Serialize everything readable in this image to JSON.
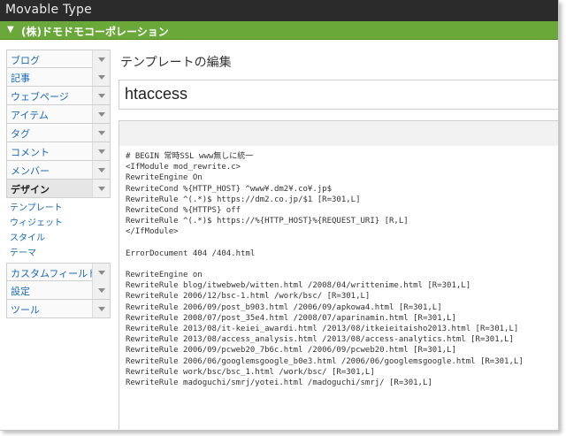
{
  "app": {
    "title": "Movable Type"
  },
  "site": {
    "name": "(株)ドモドモコーポレーション"
  },
  "sidebar": {
    "items_top": [
      {
        "label": "ブログ"
      },
      {
        "label": "記事"
      },
      {
        "label": "ウェブページ"
      },
      {
        "label": "アイテム"
      },
      {
        "label": "タグ"
      },
      {
        "label": "コメント"
      },
      {
        "label": "メンバー"
      }
    ],
    "active": {
      "label": "デザイン"
    },
    "sub_items": [
      {
        "label": "テンプレート"
      },
      {
        "label": "ウィジェット"
      },
      {
        "label": "スタイル"
      },
      {
        "label": "テーマ"
      }
    ],
    "items_bottom": [
      {
        "label": "カスタムフィールド"
      },
      {
        "label": "設定"
      },
      {
        "label": "ツール"
      }
    ]
  },
  "main": {
    "title": "テンプレートの編集",
    "template_name": "htaccess",
    "code": [
      "# BEGIN 常時SSL www無しに統一",
      "<IfModule mod_rewrite.c>",
      "RewriteEngine On",
      "RewriteCond %{HTTP_HOST} ^www¥.dm2¥.co¥.jp$",
      "RewriteRule ^(.*)$ https://dm2.co.jp/$1 [R=301,L]",
      "RewriteCond %{HTTPS} off",
      "RewriteRule ^(.*)$ https://%{HTTP_HOST}%{REQUEST_URI} [R,L]",
      "</IfModule>",
      "",
      "ErrorDocument 404 /404.html",
      "",
      "RewriteEngine on",
      "RewriteRule blog/itwebweb/witten.html /2008/04/writtenime.html [R=301,L]",
      "RewriteRule 2006/12/bsc-1.html /work/bsc/ [R=301,L]",
      "RewriteRule 2006/09/post_b903.html /2006/09/apkowa4.html [R=301,L]",
      "RewriteRule 2008/07/post_35e4.html /2008/07/aparinamin.html [R=301,L]",
      "RewriteRule 2013/08/it-keiei_awardi.html /2013/08/itkeieitaisho2013.html [R=301,L]",
      "RewriteRule 2013/08/access_analysis.html /2013/08/access-analytics.html [R=301,L]",
      "RewriteRule 2006/09/pcweb20_7b6c.html /2006/09/pcweb20.html [R=301,L]",
      "RewriteRule 2006/06/googlemsgoogle_b0e3.html /2006/06/googlemsgoogle.html [R=301,L]",
      "RewriteRule work/bsc/bsc_1.html /work/bsc/ [R=301,L]",
      "RewriteRule madoguchi/smrj/yotei.html /madoguchi/smrj/ [R=301,L]"
    ]
  },
  "colors": {
    "topbar": "#2b2b2b",
    "site_bar": "#6aa83a",
    "link": "#1a6bb5"
  },
  "icons": {
    "site_toggle": "chevron-down-icon",
    "nav_expand": "caret-down-icon"
  }
}
